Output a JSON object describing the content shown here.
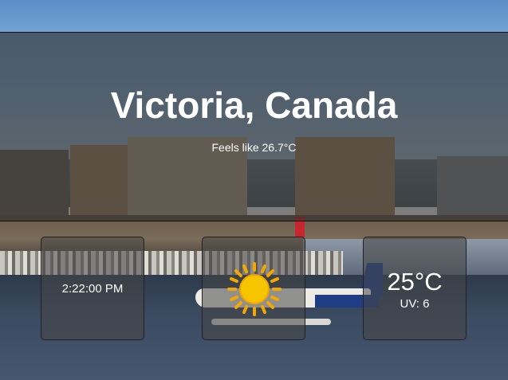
{
  "location": {
    "name": "Victoria, Canada"
  },
  "weather": {
    "feels_like": "Feels like 26.7°C",
    "time": "2:22:00 PM",
    "temperature": "25°C",
    "uv": "UV: 6",
    "condition_icon": "sun-icon"
  },
  "colors": {
    "banner_overlay": "#2d2d2d",
    "card_overlay": "#464646",
    "sun_core": "#f7c400",
    "sun_rays": "#f5a800",
    "text": "#ffffff"
  }
}
